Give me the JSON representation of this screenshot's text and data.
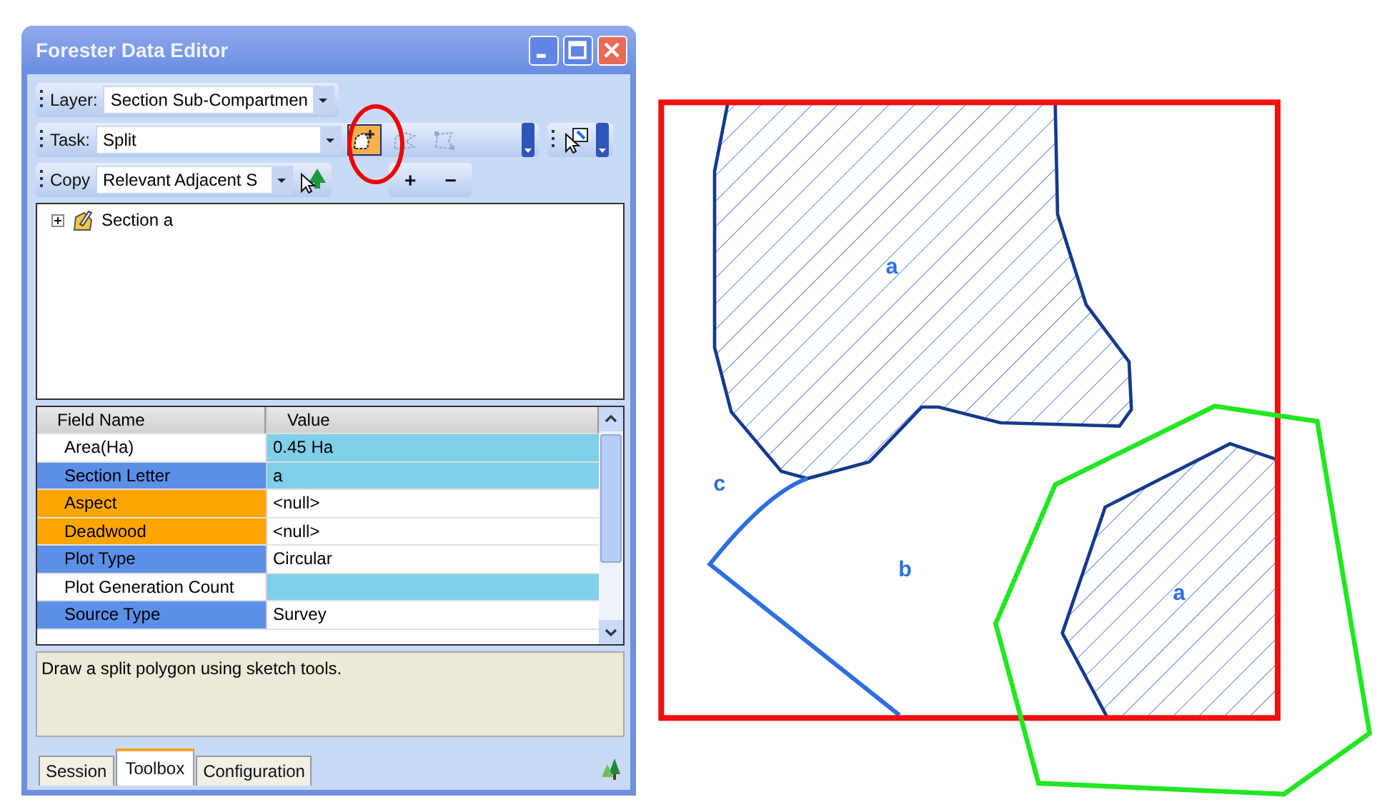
{
  "window": {
    "title": "Forester Data Editor"
  },
  "layer": {
    "label": "Layer:",
    "value": "Section Sub-Compartmen"
  },
  "task": {
    "label": "Task:",
    "value": "Split"
  },
  "tools": [
    {
      "kind": "sketch",
      "selected": true,
      "disabled": false
    },
    {
      "kind": "trace",
      "selected": false,
      "disabled": true
    },
    {
      "kind": "modify",
      "selected": false,
      "disabled": true
    }
  ],
  "copy": {
    "label": "Copy",
    "value": "Relevant Adjacent S",
    "buttons": [
      "+",
      "−"
    ]
  },
  "tree": {
    "items": [
      {
        "label": "Section a",
        "expanded": false
      }
    ]
  },
  "grid": {
    "columns": [
      "Field Name",
      "Value"
    ],
    "rows": [
      {
        "name": "Area(Ha)",
        "value": "0.45 Ha",
        "color": "#ffffff",
        "highlighted": true
      },
      {
        "name": "Section Letter",
        "value": "a",
        "color": "#5b8fe8",
        "highlighted": true
      },
      {
        "name": "Aspect",
        "value": "<null>",
        "color": "#ffa500",
        "highlighted": false
      },
      {
        "name": "Deadwood",
        "value": "<null>",
        "color": "#ffa500",
        "highlighted": false
      },
      {
        "name": "Plot Type",
        "value": "Circular",
        "color": "#5b8fe8",
        "highlighted": false
      },
      {
        "name": "Plot Generation Count",
        "value": "",
        "color": "#ffffff",
        "highlighted": true
      },
      {
        "name": "Source Type",
        "value": "Survey",
        "color": "#5b8fe8",
        "highlighted": false
      }
    ]
  },
  "description": "Draw a split polygon using sketch tools.",
  "tabs": [
    {
      "label": "Session",
      "selected": false
    },
    {
      "label": "Toolbox",
      "selected": true
    },
    {
      "label": "Configuration",
      "selected": false
    }
  ],
  "map": {
    "labels": [
      {
        "text": "a",
        "kind": "top"
      },
      {
        "text": "c",
        "kind": "left"
      },
      {
        "text": "b",
        "kind": "middle"
      },
      {
        "text": "a",
        "kind": "right"
      }
    ]
  }
}
